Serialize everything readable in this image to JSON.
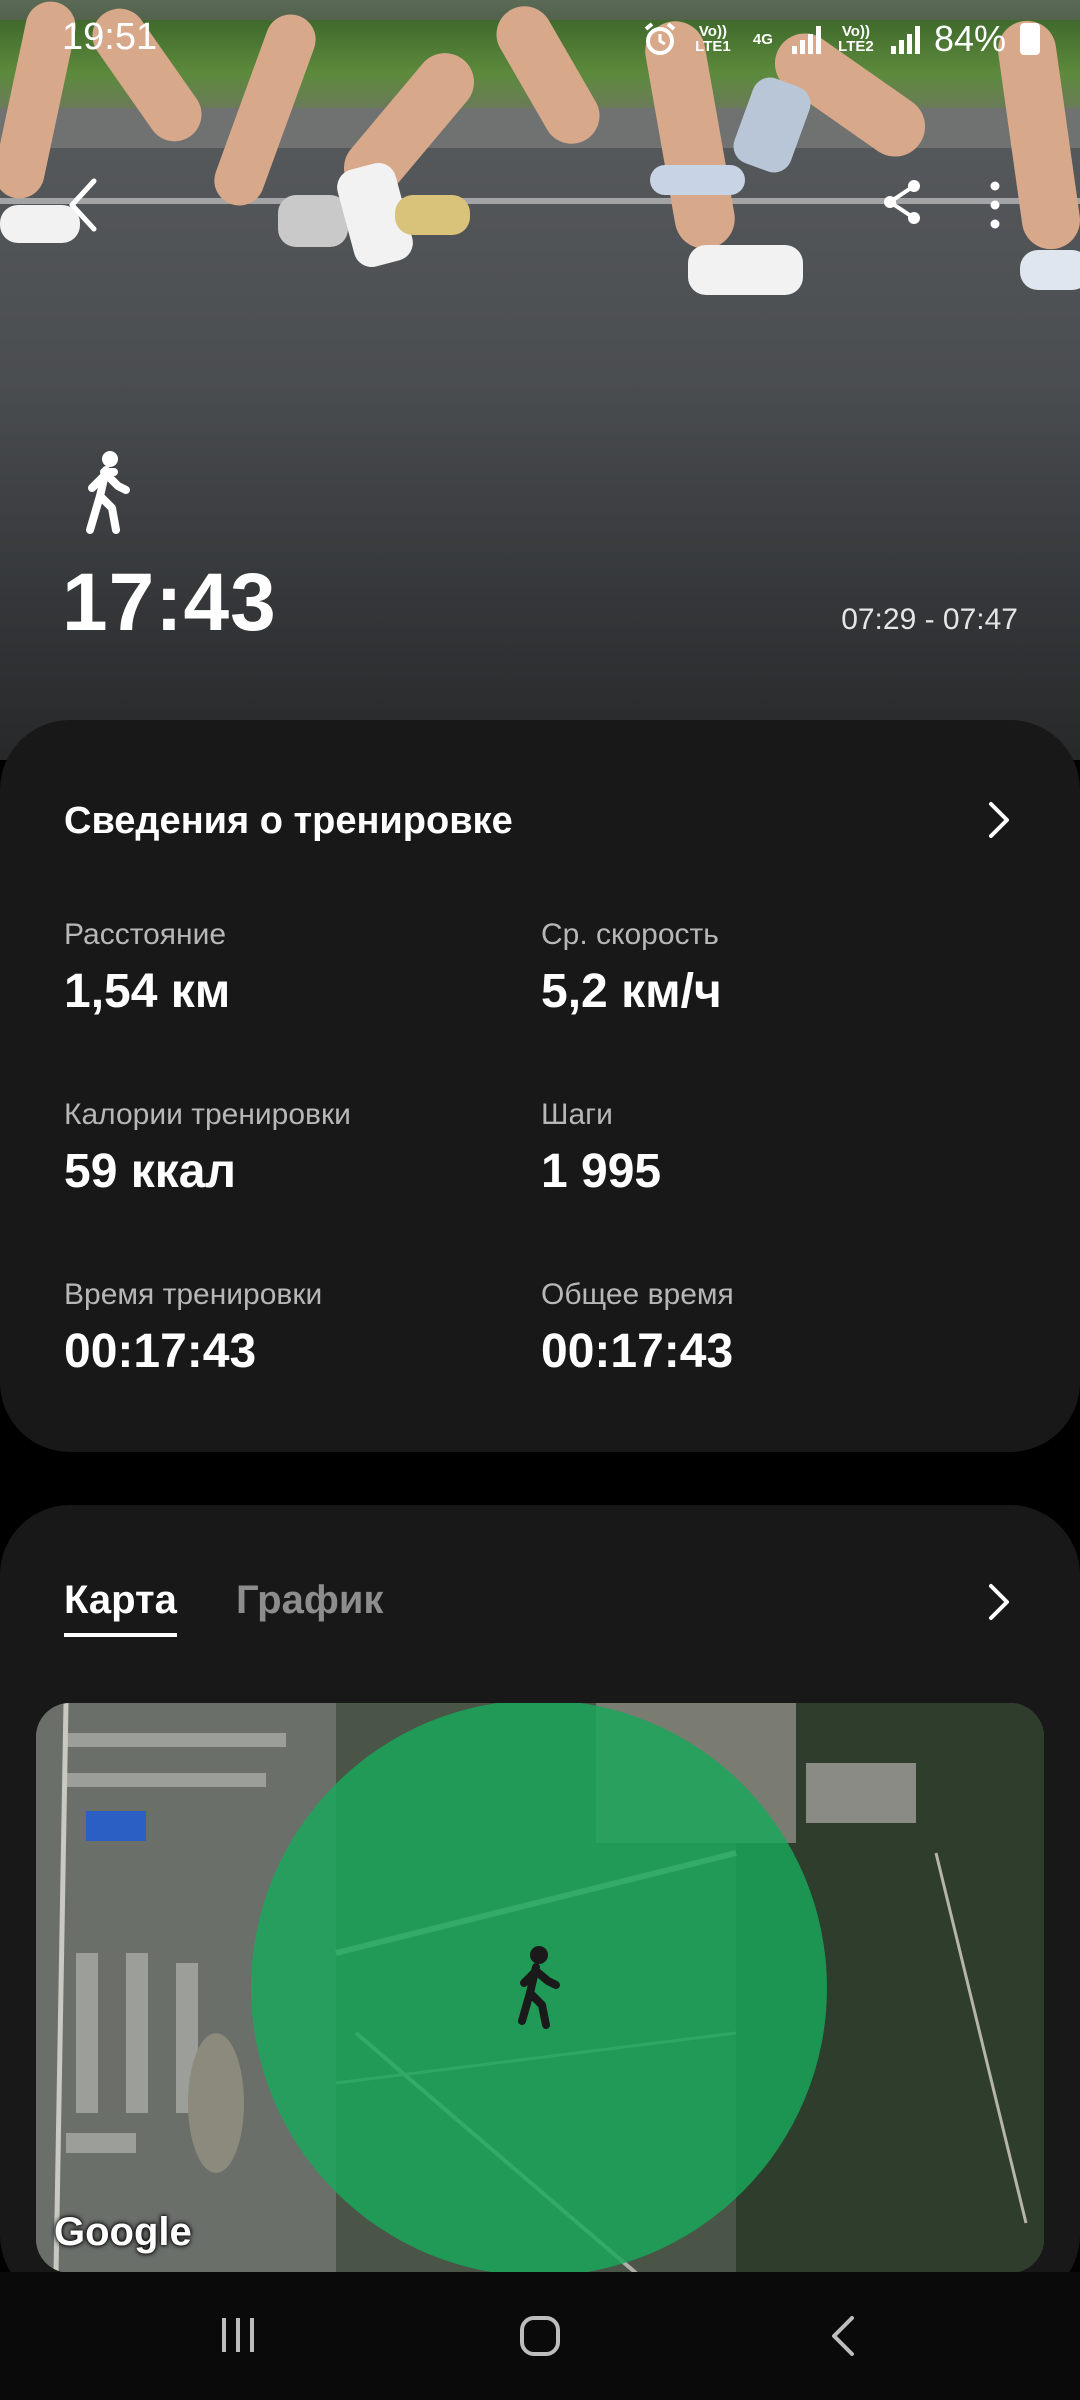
{
  "status_bar": {
    "time": "19:51",
    "sim1": "Vo)) LTE1",
    "network": "4G",
    "sim2": "Vo)) LTE2",
    "battery": "84%"
  },
  "workout": {
    "duration": "17:43",
    "time_range": "07:29 - 07:47"
  },
  "details": {
    "title": "Сведения о тренировке",
    "stats": [
      {
        "label": "Расстояние",
        "value": "1,54 км"
      },
      {
        "label": "Ср. скорость",
        "value": "5,2 км/ч"
      },
      {
        "label": "Калории тренировки",
        "value": "59 ккал"
      },
      {
        "label": "Шаги",
        "value": "1 995"
      },
      {
        "label": "Время тренировки",
        "value": "00:17:43"
      },
      {
        "label": "Общее время",
        "value": "00:17:43"
      }
    ]
  },
  "map_section": {
    "tabs": [
      {
        "label": "Карта",
        "active": true
      },
      {
        "label": "График",
        "active": false
      }
    ],
    "attribution": "Google",
    "circle_color": "#19a85a"
  },
  "colors": {
    "card_bg": "#181818",
    "background": "#000000",
    "accent_green": "#19a85a"
  }
}
